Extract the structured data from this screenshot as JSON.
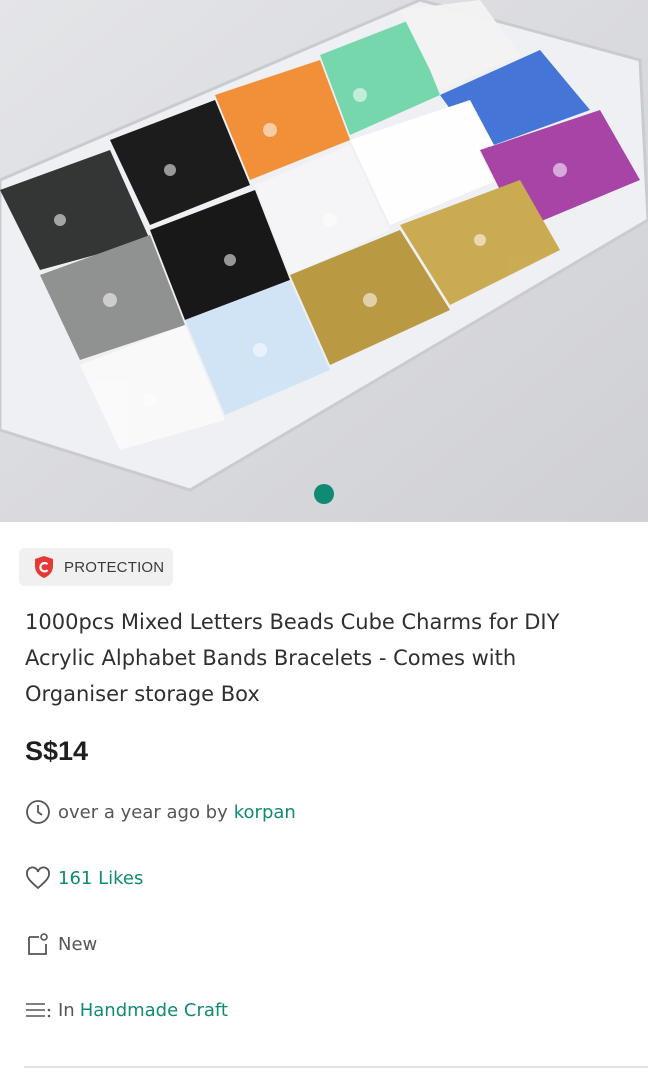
{
  "listing": {
    "image_alt": "Box of mixed letter beads in compartments",
    "carousel": {
      "total": 1,
      "active": 1
    },
    "badge": {
      "label": "PROTECTION",
      "icon": "shield-c-icon",
      "color": "#e53935"
    },
    "title": "1000pcs Mixed Letters Beads Cube Charms for DIY Acrylic Alphabet Bands Bracelets - Comes with Organiser storage Box",
    "price": "S$14",
    "posted": {
      "text": "over a year ago by",
      "seller": "korpan",
      "icon": "clock-icon"
    },
    "likes": {
      "text": "161 Likes",
      "icon": "heart-icon"
    },
    "condition": {
      "text": "New",
      "icon": "tag-icon"
    },
    "category": {
      "prefix": "In",
      "name": "Handmade Craft",
      "icon": "list-icon"
    },
    "colors": {
      "accent": "#0f8a73",
      "badge_bg": "#f0f0f0"
    }
  }
}
